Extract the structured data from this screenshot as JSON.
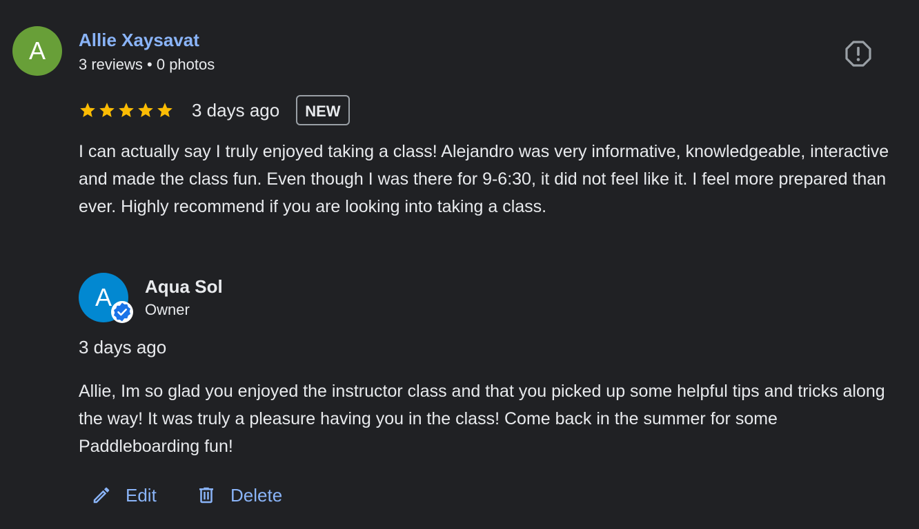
{
  "reviewer": {
    "avatar_letter": "A",
    "avatar_color": "#689f38",
    "name": "Allie Xaysavat",
    "meta": "3 reviews • 0 photos"
  },
  "review": {
    "rating": 5,
    "time": "3 days ago",
    "badge": "NEW",
    "text": "I can actually say I truly enjoyed taking a class! Alejandro was very informative, knowledgeable, interactive and made the class fun. Even though I was there for 9-6:30, it did not feel like it. I feel more prepared than ever. Highly recommend if you are looking into taking a class."
  },
  "owner_reply": {
    "avatar_letter": "A",
    "avatar_color": "#0288d1",
    "name": "Aqua Sol",
    "role": "Owner",
    "time": "3 days ago",
    "text": "Allie, Im so glad you enjoyed the instructor class and that you picked up some helpful tips and tricks along the way! It was truly a pleasure having you in the class! Come back in the summer for some Paddleboarding fun!"
  },
  "actions": {
    "edit_label": "Edit",
    "delete_label": "Delete"
  },
  "icons": {
    "report": "report-icon",
    "star": "star-icon",
    "verified": "verified-badge-icon",
    "edit": "pencil-icon",
    "delete": "trash-icon"
  },
  "colors": {
    "background": "#202124",
    "link": "#8ab4f8",
    "star": "#fbbc04",
    "verified": "#1a73e8"
  }
}
